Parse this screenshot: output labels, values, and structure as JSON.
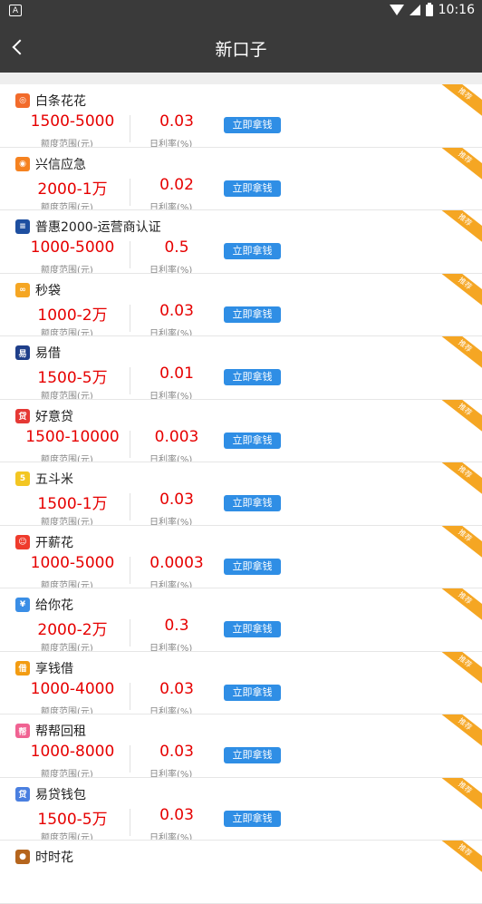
{
  "status": {
    "time": "10:16",
    "left_badge": "A"
  },
  "header": {
    "title": "新口子"
  },
  "labels": {
    "button": "立即拿钱",
    "amount_label": "额度范围(元)",
    "rate_label": "日利率(%)",
    "badge": "推荐"
  },
  "items": [
    {
      "name": "白条花花",
      "amount": "1500-5000",
      "rate": "0.03",
      "logo_color": "#f26b2b",
      "logo_glyph": "◎"
    },
    {
      "name": "兴信应急",
      "amount": "2000-1万",
      "rate": "0.02",
      "logo_color": "#f58220",
      "logo_glyph": "◉"
    },
    {
      "name": "普惠2000-运营商认证",
      "amount": "1000-5000",
      "rate": "0.5",
      "logo_color": "#1e4fa0",
      "logo_glyph": "≡"
    },
    {
      "name": "秒袋",
      "amount": "1000-2万",
      "rate": "0.03",
      "logo_color": "#f5a623",
      "logo_glyph": "∞"
    },
    {
      "name": "易借",
      "amount": "1500-5万",
      "rate": "0.01",
      "logo_color": "#1f3f8a",
      "logo_glyph": "易"
    },
    {
      "name": "好意贷",
      "amount": "1500-10000",
      "rate": "0.003",
      "logo_color": "#e53935",
      "logo_glyph": "贷"
    },
    {
      "name": "五斗米",
      "amount": "1500-1万",
      "rate": "0.03",
      "logo_color": "#f3c623",
      "logo_glyph": "5"
    },
    {
      "name": "开薪花",
      "amount": "1000-5000",
      "rate": "0.0003",
      "logo_color": "#ef3b2c",
      "logo_glyph": "☺"
    },
    {
      "name": "给你花",
      "amount": "2000-2万",
      "rate": "0.3",
      "logo_color": "#3a8ee6",
      "logo_glyph": "¥"
    },
    {
      "name": "享钱借",
      "amount": "1000-4000",
      "rate": "0.03",
      "logo_color": "#f39c12",
      "logo_glyph": "借"
    },
    {
      "name": "帮帮回租",
      "amount": "1000-8000",
      "rate": "0.03",
      "logo_color": "#f06292",
      "logo_glyph": "帮"
    },
    {
      "name": "易贷钱包",
      "amount": "1500-5万",
      "rate": "0.03",
      "logo_color": "#4a7fe0",
      "logo_glyph": "贷"
    },
    {
      "name": "时时花",
      "amount": "",
      "rate": "",
      "logo_color": "#b5651d",
      "logo_glyph": "●"
    }
  ]
}
